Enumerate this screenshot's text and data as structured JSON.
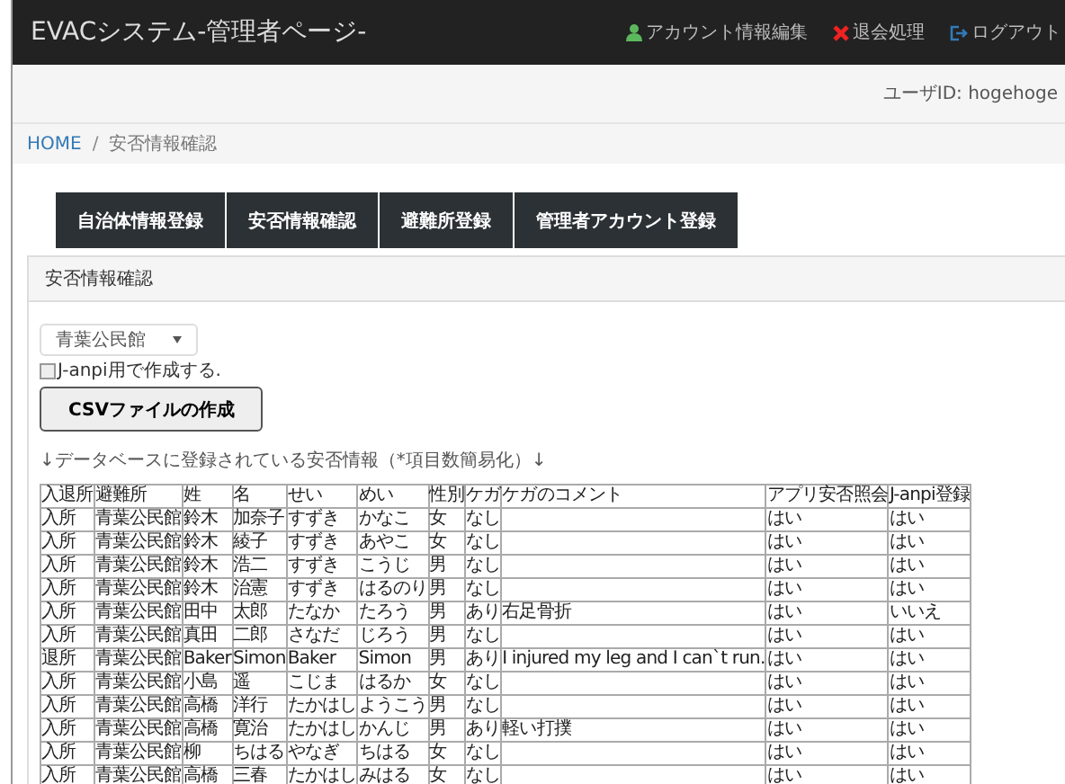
{
  "navbar": {
    "title": "EVACシステム-管理者ページ-",
    "links": [
      {
        "kind": "account",
        "label": "アカウント情報編集"
      },
      {
        "kind": "withdraw",
        "label": "退会処理"
      },
      {
        "kind": "logout",
        "label": "ログアウト"
      }
    ]
  },
  "user_bar": {
    "user_id": "ユーザID: hogehoge"
  },
  "breadcrumb_separator": "/",
  "breadcrumb": [
    {
      "label": "HOME",
      "link": true
    },
    {
      "label": "安否情報確認",
      "link": false
    }
  ],
  "menu": [
    {
      "label": "自治体情報登録"
    },
    {
      "label": "安否情報確認"
    },
    {
      "label": "避難所登録"
    },
    {
      "label": "管理者アカウント登録"
    }
  ],
  "panel": {
    "heading": "安否情報確認",
    "shelter_select": {
      "value": "青葉公民館"
    },
    "j_anpi_checkbox": {
      "label": "J-anpi用で作成する.",
      "checked": false
    },
    "csv_button": "CSVファイルの作成",
    "caption": "↓データベースに登録されている安否情報（*項目数簡易化）↓",
    "table": {
      "columns": [
        "入退所",
        "避難所",
        "姓",
        "名",
        "せい",
        "めい",
        "性別",
        "ケガ",
        "ケガのコメント",
        "アプリ安否照会",
        "J-anpi登録"
      ],
      "rows": [
        [
          "入所",
          "青葉公民館",
          "鈴木",
          "加奈子",
          "すずき",
          "かなこ",
          "女",
          "なし",
          "",
          "はい",
          "はい"
        ],
        [
          "入所",
          "青葉公民館",
          "鈴木",
          "綾子",
          "すずき",
          "あやこ",
          "女",
          "なし",
          "",
          "はい",
          "はい"
        ],
        [
          "入所",
          "青葉公民館",
          "鈴木",
          "浩二",
          "すずき",
          "こうじ",
          "男",
          "なし",
          "",
          "はい",
          "はい"
        ],
        [
          "入所",
          "青葉公民館",
          "鈴木",
          "治憲",
          "すずき",
          "はるのり",
          "男",
          "なし",
          "",
          "はい",
          "はい"
        ],
        [
          "入所",
          "青葉公民館",
          "田中",
          "太郎",
          "たなか",
          "たろう",
          "男",
          "あり",
          "右足骨折",
          "はい",
          "いいえ"
        ],
        [
          "入所",
          "青葉公民館",
          "真田",
          "二郎",
          "さなだ",
          "じろう",
          "男",
          "なし",
          "",
          "はい",
          "はい"
        ],
        [
          "退所",
          "青葉公民館",
          "Baker",
          "Simon",
          "Baker",
          "Simon",
          "男",
          "あり",
          "I injured my leg and I can`t run.",
          "はい",
          "はい"
        ],
        [
          "入所",
          "青葉公民館",
          "小島",
          "遥",
          "こじま",
          "はるか",
          "女",
          "なし",
          "",
          "はい",
          "はい"
        ],
        [
          "入所",
          "青葉公民館",
          "高橋",
          "洋行",
          "たかはし",
          "ようこう",
          "男",
          "なし",
          "",
          "はい",
          "はい"
        ],
        [
          "入所",
          "青葉公民館",
          "高橋",
          "寛治",
          "たかはし",
          "かんじ",
          "男",
          "あり",
          "軽い打撲",
          "はい",
          "はい"
        ],
        [
          "入所",
          "青葉公民館",
          "柳",
          "ちはる",
          "やなぎ",
          "ちはる",
          "女",
          "なし",
          "",
          "はい",
          "はい"
        ],
        [
          "入所",
          "青葉公民館",
          "高橋",
          "三春",
          "たかはし",
          "みはる",
          "女",
          "なし",
          "",
          "はい",
          "はい"
        ]
      ]
    }
  }
}
